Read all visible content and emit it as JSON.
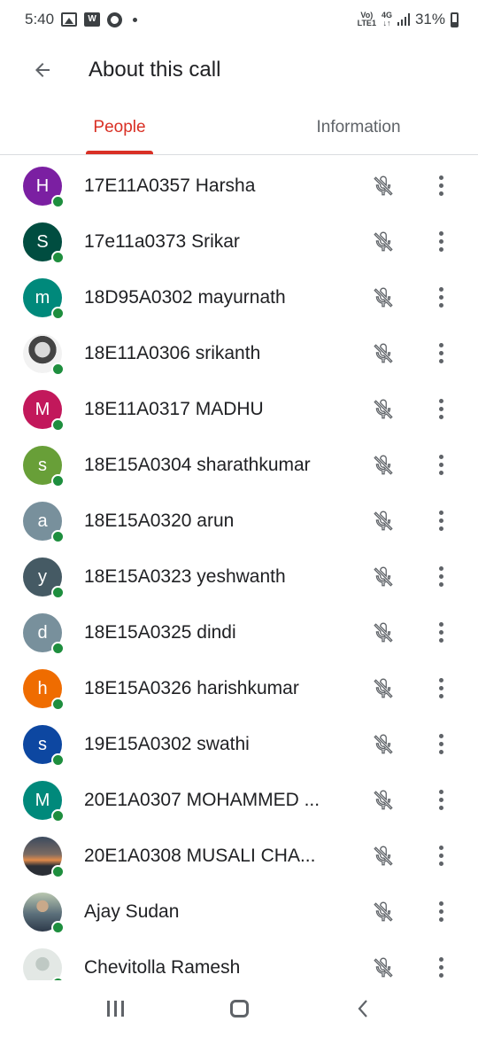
{
  "status_bar": {
    "time": "5:40",
    "w_icon_label": "W",
    "volte_label_top": "Vo)",
    "volte_label_bottom": "LTE1",
    "network_top": "4G",
    "network_bottom": "↓↑",
    "battery": "31%",
    "icons": [
      "gallery-icon",
      "w-app-icon",
      "chrome-icon",
      "notification-dot-icon",
      "volte-icon",
      "signal-icon",
      "battery-icon"
    ]
  },
  "header": {
    "title": "About this call",
    "back_icon": "arrow-back-icon"
  },
  "tabs": [
    {
      "label": "People",
      "active": true
    },
    {
      "label": "Information",
      "active": false
    }
  ],
  "colors": {
    "accent": "#d93025",
    "online": "#1e8e3e",
    "icon_gray": "#5f6368"
  },
  "participants": [
    {
      "name": "17E11A0357 Harsha",
      "initial": "H",
      "color": "#7b1fa2",
      "photo": false
    },
    {
      "name": "17e11a0373 Srikar",
      "initial": "S",
      "color": "#004d40",
      "photo": false
    },
    {
      "name": "18D95A0302 mayurnath",
      "initial": "m",
      "color": "#00897b",
      "photo": false
    },
    {
      "name": "18E11A0306 srikanth",
      "initial": "",
      "color": "#ffffff",
      "photo": true,
      "photo_style": "bw-figure"
    },
    {
      "name": "18E11A0317 MADHU",
      "initial": "M",
      "color": "#c2185b",
      "photo": false
    },
    {
      "name": "18E15A0304 sharathkumar",
      "initial": "s",
      "color": "#689f38",
      "photo": false
    },
    {
      "name": "18E15A0320 arun",
      "initial": "a",
      "color": "#78909c",
      "photo": false
    },
    {
      "name": "18E15A0323 yeshwanth",
      "initial": "y",
      "color": "#455a64",
      "photo": false
    },
    {
      "name": "18E15A0325 dindi",
      "initial": "d",
      "color": "#78909c",
      "photo": false
    },
    {
      "name": "18E15A0326 harishkumar",
      "initial": "h",
      "color": "#ef6c00",
      "photo": false
    },
    {
      "name": "19E15A0302 swathi",
      "initial": "s",
      "color": "#0d47a1",
      "photo": false
    },
    {
      "name": "20E1A0307 MOHAMMED ...",
      "initial": "M",
      "color": "#00897b",
      "photo": false
    },
    {
      "name": "20E1A0308 MUSALI CHA...",
      "initial": "",
      "color": "#ffffff",
      "photo": true,
      "photo_style": "sunset"
    },
    {
      "name": "Ajay Sudan",
      "initial": "",
      "color": "#ffffff",
      "photo": true,
      "photo_style": "person-outdoor"
    },
    {
      "name": "Chevitolla Ramesh",
      "initial": "",
      "color": "#ffffff",
      "photo": true,
      "photo_style": "faded-portrait"
    }
  ],
  "row_icons": {
    "mute": "mic-off-icon",
    "more": "more-vert-icon"
  },
  "nav_bar": {
    "buttons": [
      "recents-icon",
      "home-icon",
      "back-nav-icon"
    ]
  }
}
